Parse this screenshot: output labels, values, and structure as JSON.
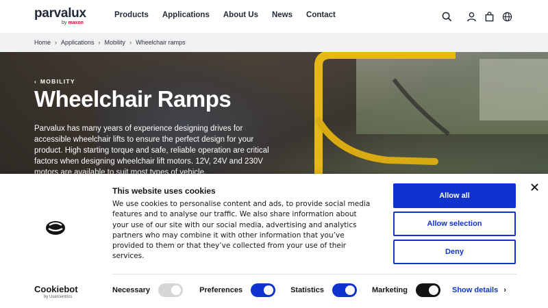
{
  "header": {
    "logo": "parvalux",
    "logo_sub_prefix": "by",
    "logo_sub_brand": "maxon",
    "nav": [
      "Products",
      "Applications",
      "About Us",
      "News",
      "Contact"
    ],
    "icons": [
      "search-icon",
      "user-icon",
      "cart-icon",
      "globe-icon"
    ]
  },
  "breadcrumb": [
    "Home",
    "Applications",
    "Mobility",
    "Wheelchair ramps"
  ],
  "hero": {
    "eyebrow": "MOBILITY",
    "title": "Wheelchair Ramps",
    "text": "Parvalux has many years of experience designing drives for accessible wheelchair lifts to ensure the perfect design for your product. High starting torque and safe, reliable operation are critical factors when designing wheelchair lift motors. 12V, 24V and 230V motors are available to suit most types of vehicle."
  },
  "cookie": {
    "title": "This website uses cookies",
    "text": "We use cookies to personalise content and ads, to provide social media features and to analyse our traffic. We also share information about your use of our site with our social media, advertising and analytics partners who may combine it with other information that you’ve provided to them or that they’ve collected from your use of their services.",
    "buttons": {
      "allow_all": "Allow all",
      "allow_selection": "Allow selection",
      "deny": "Deny"
    },
    "brand": "Cookiebot",
    "brand_sub": "by Usercentrics",
    "toggles": [
      {
        "label": "Necessary",
        "state": "on-disabled"
      },
      {
        "label": "Preferences",
        "state": "on"
      },
      {
        "label": "Statistics",
        "state": "on"
      },
      {
        "label": "Marketing",
        "state": "on"
      }
    ],
    "show_details": "Show details"
  },
  "colors": {
    "accent": "#1032cf",
    "text": "#141414",
    "rail": "#e6b817"
  }
}
